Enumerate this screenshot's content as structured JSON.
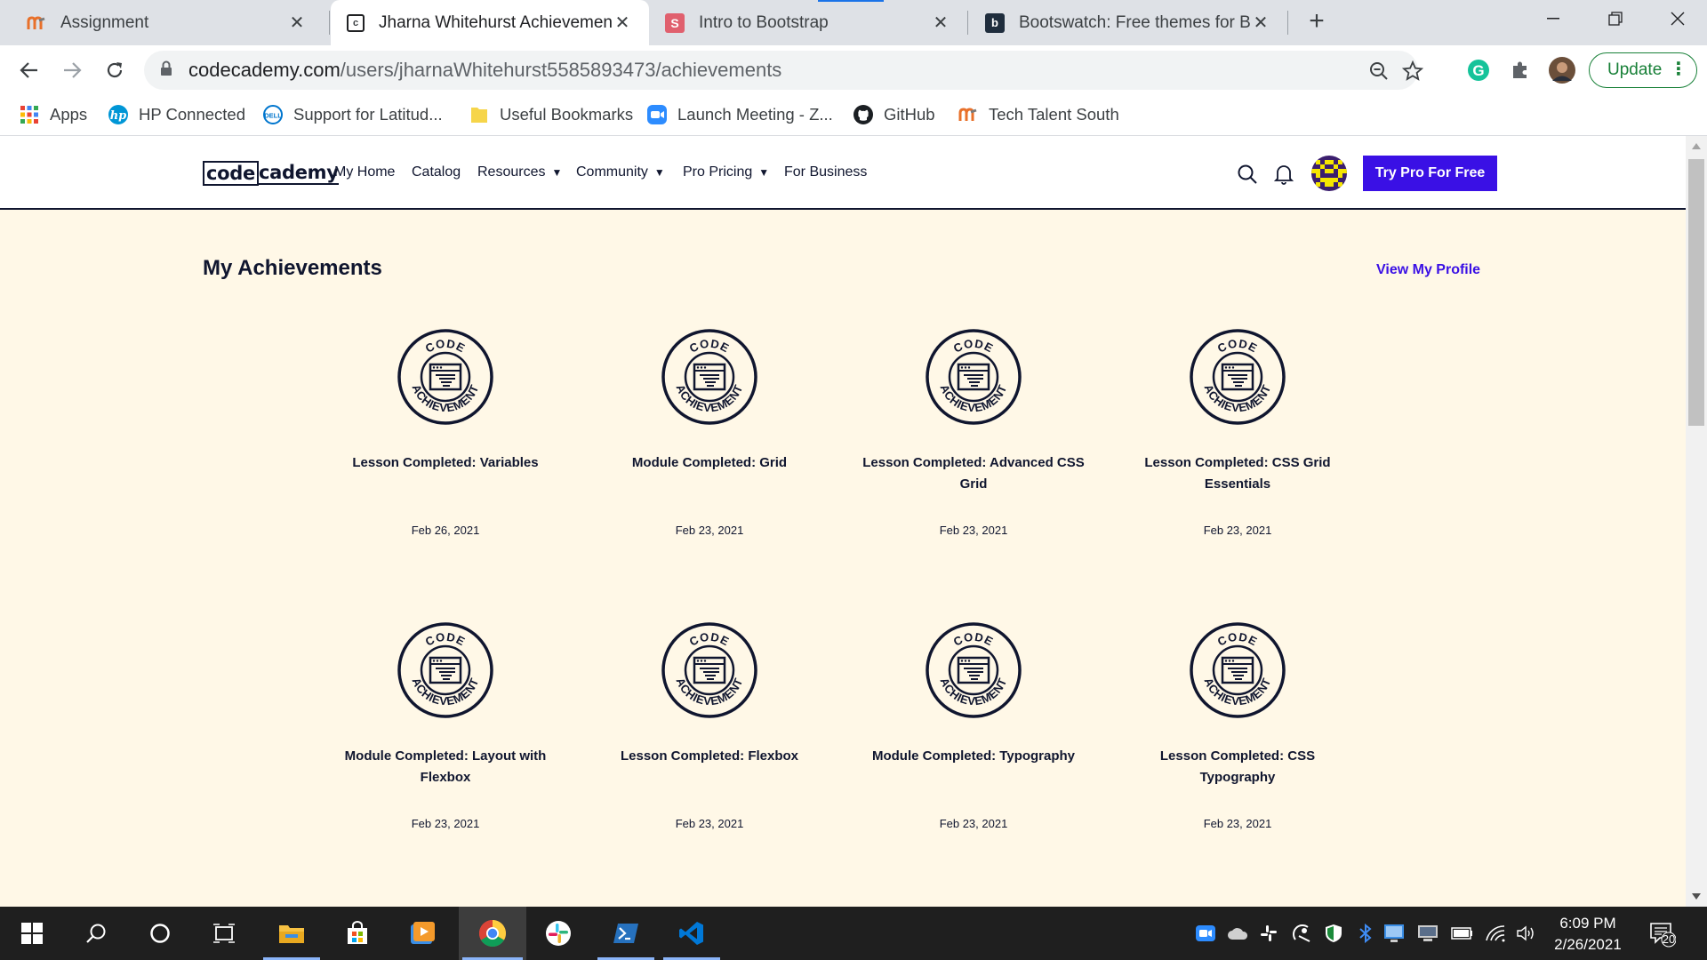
{
  "browser": {
    "tabs": [
      {
        "title": "Assignment",
        "favicon": "tech-talent-south-icon",
        "active": false
      },
      {
        "title": "Jharna Whitehurst Achievements",
        "favicon": "codecademy-icon",
        "active": true
      },
      {
        "title": "Intro to Bootstrap",
        "favicon": "slides-icon",
        "active": false
      },
      {
        "title": "Bootswatch: Free themes for Boo",
        "favicon": "bootswatch-icon",
        "active": false
      }
    ],
    "url_host": "codecademy.com",
    "url_path": "/users/jharnaWhitehurst5585893473/achievements",
    "update_label": "Update",
    "bookmarks": [
      {
        "label": "Apps",
        "icon": "apps-grid-icon"
      },
      {
        "label": "HP Connected",
        "icon": "hp-icon"
      },
      {
        "label": "Support for Latitud...",
        "icon": "dell-icon"
      },
      {
        "label": "Useful Bookmarks",
        "icon": "folder-icon"
      },
      {
        "label": "Launch Meeting - Z...",
        "icon": "zoom-icon"
      },
      {
        "label": "GitHub",
        "icon": "github-icon"
      },
      {
        "label": "Tech Talent South",
        "icon": "tech-talent-south-icon"
      }
    ]
  },
  "site": {
    "logo_left": "code",
    "logo_right": "cademy",
    "nav": {
      "home": "My Home",
      "catalog": "Catalog",
      "resources": "Resources",
      "community": "Community",
      "pricing": "Pro Pricing",
      "business": "For Business"
    },
    "try_pro": "Try Pro For Free",
    "brand_color": "#3a10e5",
    "page_bg": "#fff8e7"
  },
  "achievements": {
    "title": "My Achievements",
    "view_profile": "View My Profile",
    "badge": {
      "top_text": "CODE",
      "bottom_text": "ACHIEVEMENT"
    },
    "items": [
      {
        "name": "Lesson Completed: Variables",
        "date": "Feb 26, 2021"
      },
      {
        "name": "Module Completed: Grid",
        "date": "Feb 23, 2021"
      },
      {
        "name": "Lesson Completed: Advanced CSS Grid",
        "date": "Feb 23, 2021"
      },
      {
        "name": "Lesson Completed: CSS Grid Essentials",
        "date": "Feb 23, 2021"
      },
      {
        "name": "Module Completed: Layout with Flexbox",
        "date": "Feb 23, 2021"
      },
      {
        "name": "Lesson Completed: Flexbox",
        "date": "Feb 23, 2021"
      },
      {
        "name": "Module Completed: Typography",
        "date": "Feb 23, 2021"
      },
      {
        "name": "Lesson Completed: CSS Typography",
        "date": "Feb 23, 2021"
      }
    ]
  },
  "taskbar": {
    "apps": [
      "start-icon",
      "search-icon",
      "cortana-icon",
      "task-view-icon",
      "file-explorer-icon",
      "store-icon",
      "media-player-icon",
      "chrome-icon",
      "slack-icon",
      "powershell-icon",
      "vscode-icon"
    ],
    "time": "6:09 PM",
    "date": "2/26/2021",
    "notification_count": "20"
  }
}
